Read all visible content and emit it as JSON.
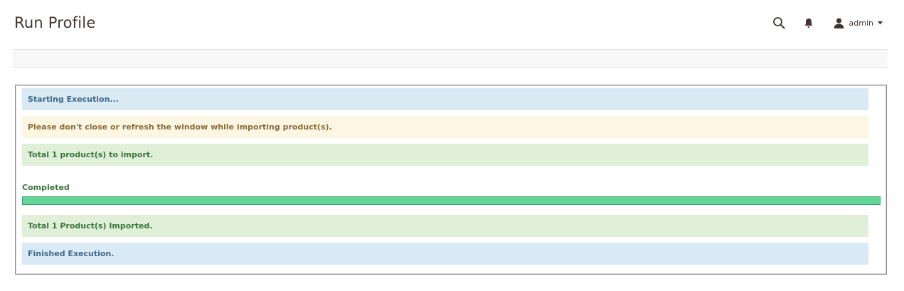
{
  "header": {
    "title": "Run Profile",
    "user": {
      "name": "admin",
      "icon": "user-icon",
      "caret_icon": "caret-down-icon"
    },
    "search_icon": "search-icon",
    "notification_icon": "bell-icon"
  },
  "run": {
    "messages": {
      "starting": "Starting Execution...",
      "notice": "Please don't close or refresh the window while importing product(s).",
      "total": "Total 1 product(s) to import.",
      "imported": "Total 1 Product(s) Imported.",
      "finished": "Finished Execution."
    },
    "progress": {
      "label": "Completed",
      "percent": 100
    }
  },
  "colors": {
    "info_bg": "#d9eaf4",
    "warning_bg": "#fcf6e3",
    "success_bg": "#dfefd8",
    "progress_fill": "#62d699"
  }
}
